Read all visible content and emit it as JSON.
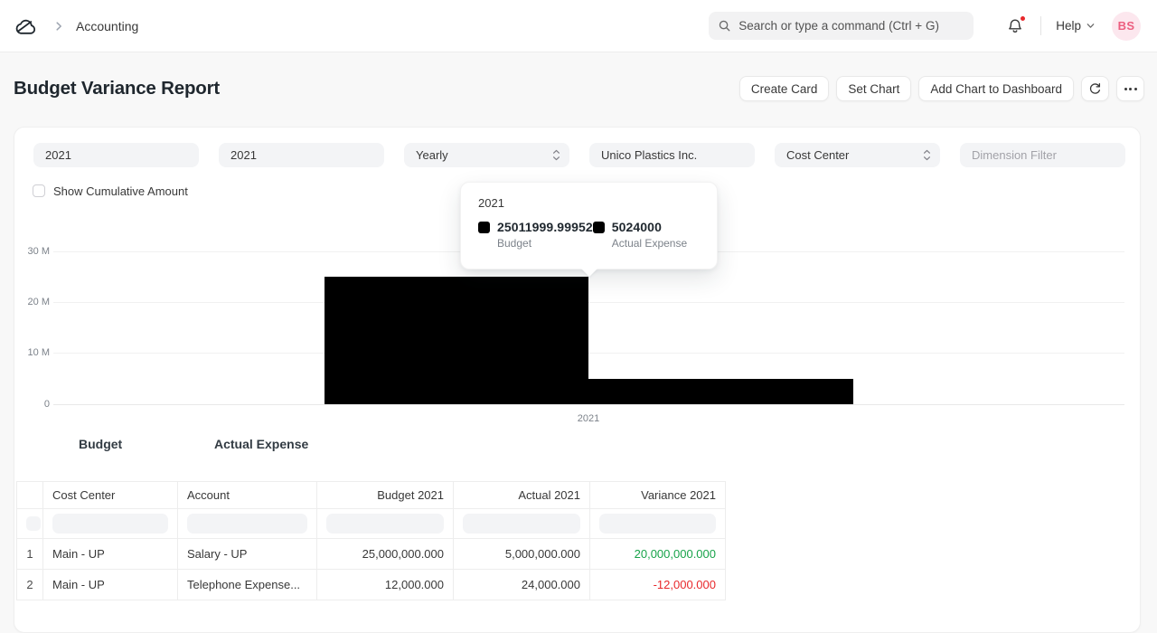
{
  "nav": {
    "breadcrumb": "Accounting",
    "search_placeholder": "Search or type a command (Ctrl + G)",
    "help_label": "Help",
    "avatar_initials": "BS"
  },
  "header": {
    "title": "Budget Variance Report",
    "create_card": "Create Card",
    "set_chart": "Set Chart",
    "add_chart": "Add Chart to Dashboard"
  },
  "filters": {
    "from_year": "2021",
    "to_year": "2021",
    "periodicity": "Yearly",
    "company": "Unico Plastics Inc.",
    "budget_against": "Cost Center",
    "dimension_placeholder": "Dimension Filter",
    "cumulative_label": "Show Cumulative Amount"
  },
  "chart_data": {
    "type": "bar",
    "categories": [
      "2021"
    ],
    "series": [
      {
        "name": "Budget",
        "values": [
          25011999.99952
        ]
      },
      {
        "name": "Actual Expense",
        "values": [
          5024000
        ]
      }
    ],
    "title": "",
    "xlabel": "",
    "ylabel": "",
    "ylim": [
      0,
      30000000
    ],
    "yticks": [
      "30 M",
      "20 M",
      "10 M",
      "0"
    ],
    "grid": true,
    "legend_position": "bottom",
    "bar_color": "#000000",
    "legend": [
      "Budget",
      "Actual Expense"
    ],
    "tooltip": {
      "title": "2021",
      "items": [
        {
          "value": "25011999.99952",
          "label": "Budget"
        },
        {
          "value": "5024000",
          "label": "Actual Expense"
        }
      ]
    }
  },
  "table": {
    "headers": [
      "",
      "Cost Center",
      "Account",
      "Budget 2021",
      "Actual 2021",
      "Variance 2021"
    ],
    "rows": [
      {
        "idx": "1",
        "cost_center": "Main - UP",
        "account": "Salary - UP",
        "budget": "25,000,000.000",
        "actual": "5,000,000.000",
        "variance": "20,000,000.000",
        "variance_color": "#18a34a"
      },
      {
        "idx": "2",
        "cost_center": "Main - UP",
        "account": "Telephone Expense...",
        "budget": "12,000.000",
        "actual": "24,000.000",
        "variance": "-12,000.000",
        "variance_color": "#e8282b"
      }
    ]
  },
  "colors": {
    "positive": "#18a34a",
    "negative": "#e8282b",
    "notification_dot": "#e8282b",
    "avatar_bg": "#fce7ee",
    "avatar_text": "#ec5e7f",
    "bar": "#000000"
  }
}
